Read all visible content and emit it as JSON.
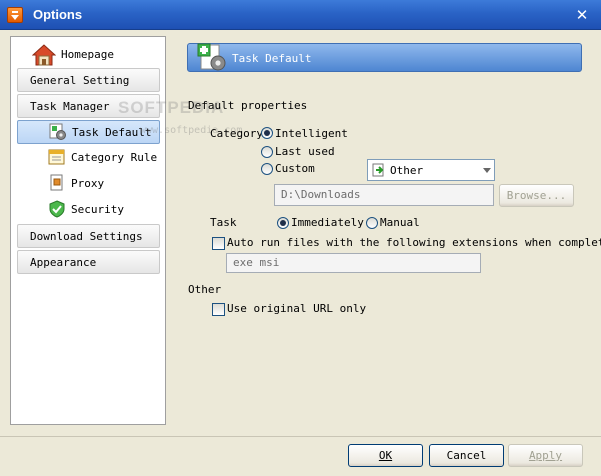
{
  "window": {
    "title": "Options"
  },
  "sidebar": {
    "items": [
      {
        "label": "Homepage"
      },
      {
        "label": "General Setting"
      },
      {
        "label": "Task Manager"
      },
      {
        "label": "Task Default"
      },
      {
        "label": "Category Rule"
      },
      {
        "label": "Proxy"
      },
      {
        "label": "Security"
      },
      {
        "label": "Download Settings"
      },
      {
        "label": "Appearance"
      }
    ]
  },
  "header": {
    "title": "Task Default"
  },
  "watermark": {
    "text": "SOFTPEDIA",
    "url": "www.softpedia.com"
  },
  "default_properties": {
    "section_label": "Default properties",
    "category_label": "Category",
    "options": [
      "Intelligent",
      "Last used",
      "Custom"
    ],
    "selected": "Intelligent",
    "custom_category": "Other",
    "path_value": "D:\\Downloads",
    "browse_label": "Browse...",
    "task_label": "Task",
    "task_options": [
      "Immediately",
      "Manual"
    ],
    "task_selected": "Immediately",
    "auto_run_label": "Auto run files with the following extensions when complete",
    "auto_run_checked": false,
    "extensions_value": "exe msi"
  },
  "other": {
    "section_label": "Other",
    "original_url_label": "Use original URL only",
    "original_url_checked": false
  },
  "buttons": {
    "ok": "OK",
    "cancel": "Cancel",
    "apply": "Apply"
  },
  "colors": {
    "titlebar": "#2a63c6",
    "header_bar": "#6a9ee0",
    "selected_item": "#c9def7"
  }
}
